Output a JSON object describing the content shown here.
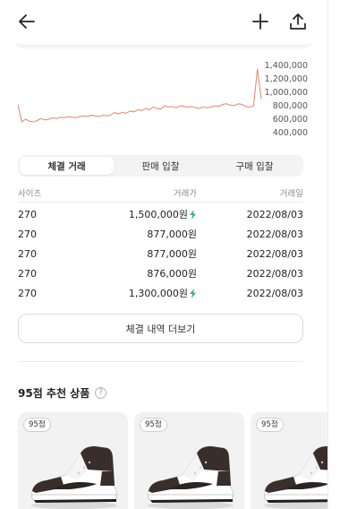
{
  "header": {
    "back_icon": "arrow-left-icon",
    "add_icon": "plus-icon",
    "share_icon": "share-upload-icon"
  },
  "chart_data": {
    "type": "line",
    "y_ticks": [
      "1,400,000",
      "1,200,000",
      "1,000,000",
      "800,000",
      "600,000",
      "400,000"
    ],
    "ylim": [
      400000,
      1400000
    ],
    "line_color": "#e8836a",
    "y": [
      820000,
      560000,
      600000,
      570000,
      560000,
      580000,
      610000,
      590000,
      600000,
      620000,
      610000,
      630000,
      620000,
      640000,
      630000,
      620000,
      640000,
      650000,
      640000,
      660000,
      650000,
      640000,
      660000,
      650000,
      660000,
      700000,
      680000,
      700000,
      690000,
      720000,
      710000,
      740000,
      730000,
      760000,
      740000,
      780000,
      760000,
      750000,
      800000,
      780000,
      790000,
      770000,
      800000,
      790000,
      780000,
      790000,
      770000,
      760000,
      780000,
      770000,
      780000,
      800000,
      790000,
      820000,
      830000,
      810000,
      800000,
      830000,
      820000,
      790000,
      780000,
      800000,
      1350000,
      900000
    ]
  },
  "tabs": [
    {
      "label": "체결 거래",
      "active": true
    },
    {
      "label": "판매 입찰",
      "active": false
    },
    {
      "label": "구매 입찰",
      "active": false
    }
  ],
  "table": {
    "headers": [
      "사이즈",
      "거래가",
      "거래일"
    ],
    "rows": [
      {
        "size": "270",
        "price": "1,500,000원",
        "date": "2022/08/03",
        "fast": true
      },
      {
        "size": "270",
        "price": "877,000원",
        "date": "2022/08/03",
        "fast": false
      },
      {
        "size": "270",
        "price": "877,000원",
        "date": "2022/08/03",
        "fast": false
      },
      {
        "size": "270",
        "price": "876,000원",
        "date": "2022/08/03",
        "fast": false
      },
      {
        "size": "270",
        "price": "1,300,000원",
        "date": "2022/08/03",
        "fast": true
      }
    ]
  },
  "more_button": "체결 내역 더보기",
  "recommend": {
    "title": "95점 추천 상품",
    "help": "?",
    "cards": [
      {
        "badge": "95점"
      },
      {
        "badge": "95점"
      },
      {
        "badge": "95점"
      }
    ]
  },
  "colors": {
    "accent_bolt": "#31b46e",
    "line": "#e8836a"
  }
}
